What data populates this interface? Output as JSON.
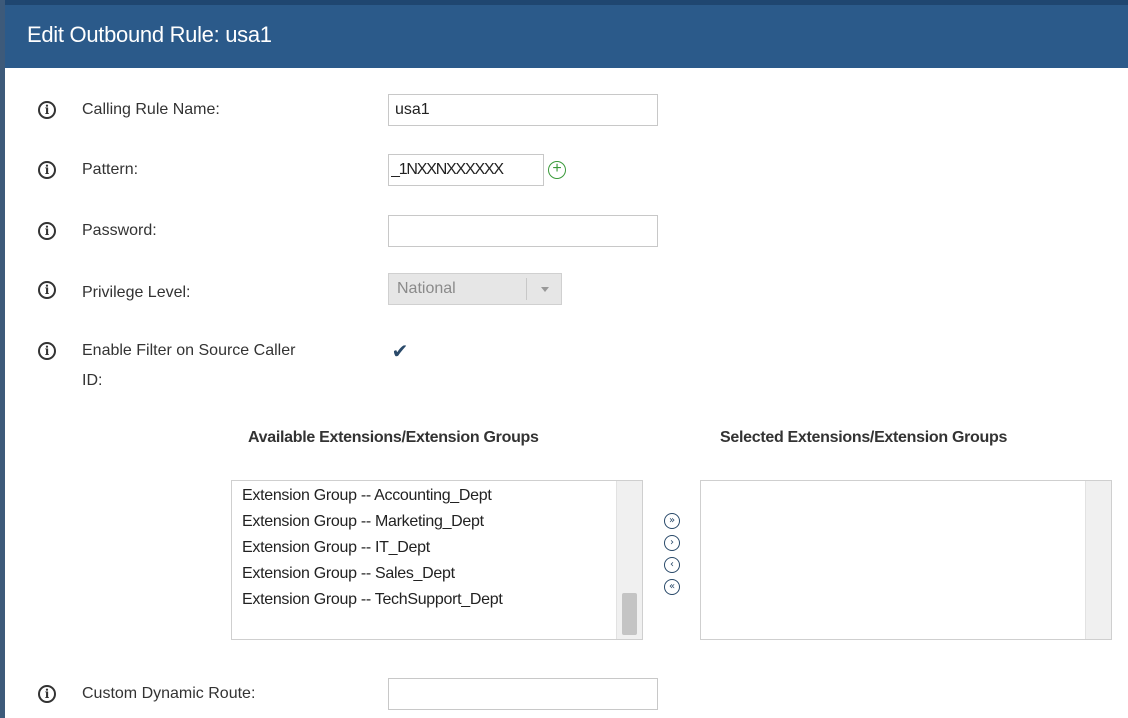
{
  "header": {
    "title": "Edit Outbound Rule: usa1"
  },
  "form": {
    "calling_rule_name": {
      "label": "Calling Rule Name:",
      "value": "usa1"
    },
    "pattern": {
      "label": "Pattern:",
      "value": "_1NXXNXXXXXX"
    },
    "password": {
      "label": "Password:",
      "value": ""
    },
    "privilege_level": {
      "label": "Privilege Level:",
      "value": "National"
    },
    "enable_filter": {
      "label_line1": "Enable Filter on Source Caller",
      "label_line2": "ID:",
      "checked": true,
      "check_glyph": "✔"
    },
    "custom_dynamic_route": {
      "label": "Custom Dynamic Route:",
      "value": ""
    }
  },
  "extensions": {
    "available_header": "Available Extensions/Extension Groups",
    "selected_header": "Selected Extensions/Extension Groups",
    "available": [
      "Extension Group -- Accounting_Dept",
      "Extension Group -- Marketing_Dept",
      "Extension Group -- IT_Dept",
      "Extension Group -- Sales_Dept",
      "Extension Group -- TechSupport_Dept"
    ],
    "selected": []
  },
  "controls": {
    "info_glyph": "i",
    "plus_glyph": "+",
    "move_all_right_glyph": "»",
    "move_right_glyph": "›",
    "move_left_glyph": "‹",
    "move_all_left_glyph": "«"
  },
  "colors": {
    "header_bg": "#2b5a8a",
    "add_icon": "#3a9a3a",
    "icon_dark": "#2a4a6a"
  }
}
